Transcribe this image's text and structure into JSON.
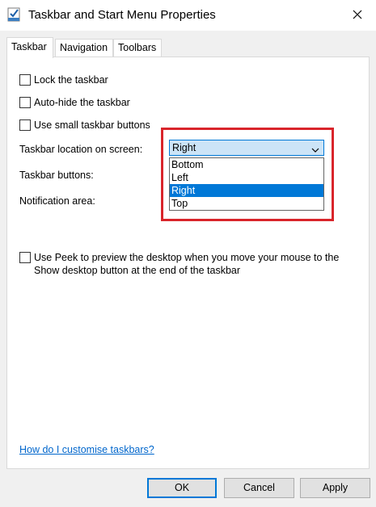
{
  "window": {
    "title": "Taskbar and Start Menu Properties",
    "icon": "taskbar-properties-icon",
    "close_icon": "close-icon"
  },
  "tabs": [
    {
      "label": "Taskbar",
      "active": true
    },
    {
      "label": "Navigation",
      "active": false
    },
    {
      "label": "Toolbars",
      "active": false
    }
  ],
  "taskbar": {
    "checkboxes": [
      {
        "label": "Lock the taskbar",
        "checked": false
      },
      {
        "label": "Auto-hide the taskbar",
        "checked": false
      },
      {
        "label": "Use small taskbar buttons",
        "checked": false
      }
    ],
    "location_label": "Taskbar location on screen:",
    "buttons_label": "Taskbar buttons:",
    "notification_label": "Notification area:",
    "location_combo": {
      "value": "Right",
      "options": [
        "Bottom",
        "Left",
        "Right",
        "Top"
      ],
      "selected": "Right"
    },
    "peek_checkbox": {
      "label": "Use Peek to preview the desktop when you move your mouse to the Show desktop button at the end of the taskbar",
      "checked": false
    },
    "help_link": "How do I customise taskbars?"
  },
  "footer": {
    "ok_label": "OK",
    "cancel_label": "Cancel",
    "apply_label": "Apply"
  },
  "colors": {
    "accent": "#0078d7",
    "highlight_box": "#d9252b",
    "link": "#0066cc",
    "panel_bg": "#ffffff",
    "window_bg": "#f0f0f0"
  }
}
